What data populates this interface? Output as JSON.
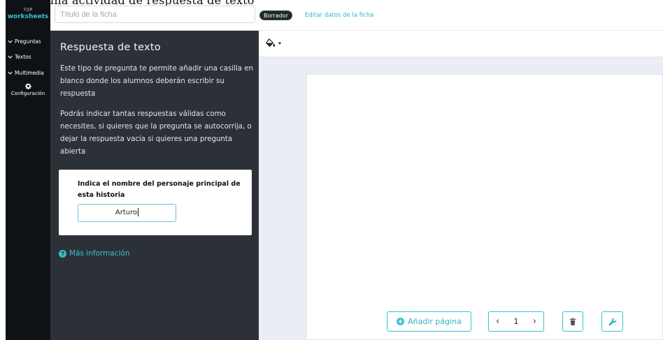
{
  "app": {
    "logo_top": "TOP",
    "logo_bottom": "worksheets",
    "top_strip_text": "Crear una actividad de respuesta de texto"
  },
  "sidebar": {
    "items": [
      {
        "label": "Preguntas"
      },
      {
        "label": "Textos"
      },
      {
        "label": "Multimedia"
      }
    ],
    "config_label": "Configuración"
  },
  "header": {
    "title_placeholder": "Título de la ficha",
    "title_value": "",
    "status_badge": "Borrador",
    "edit_link": "Editar datos de la ficha"
  },
  "panel": {
    "title": "Respuesta de texto",
    "paragraph1": "Este tipo de pregunta te permite añadir una casilla en blanco donde los alumnos deberán escribir su respuesta",
    "paragraph2": "Podrás indicar tantas respuestas válidas como necesites, si quieres que la pregunta se autocorrija, o dejar la respuesta vacía si quieres una pregunta abierta",
    "example_question": "Indica el nombre del personaje principal de esta historia",
    "example_answer": "Arturo",
    "more_info": "Más información"
  },
  "toolbar": {
    "paint_icon": "paint-bucket-icon",
    "dropdown_icon": "caret-down-icon"
  },
  "canvas": {
    "add_page_label": "Añadir página",
    "current_page": "1"
  },
  "colors": {
    "accent": "#37c1d4",
    "panel_bg": "#2c3137",
    "rail_bg": "#0f1215",
    "canvas_bg": "#ebedf5"
  }
}
